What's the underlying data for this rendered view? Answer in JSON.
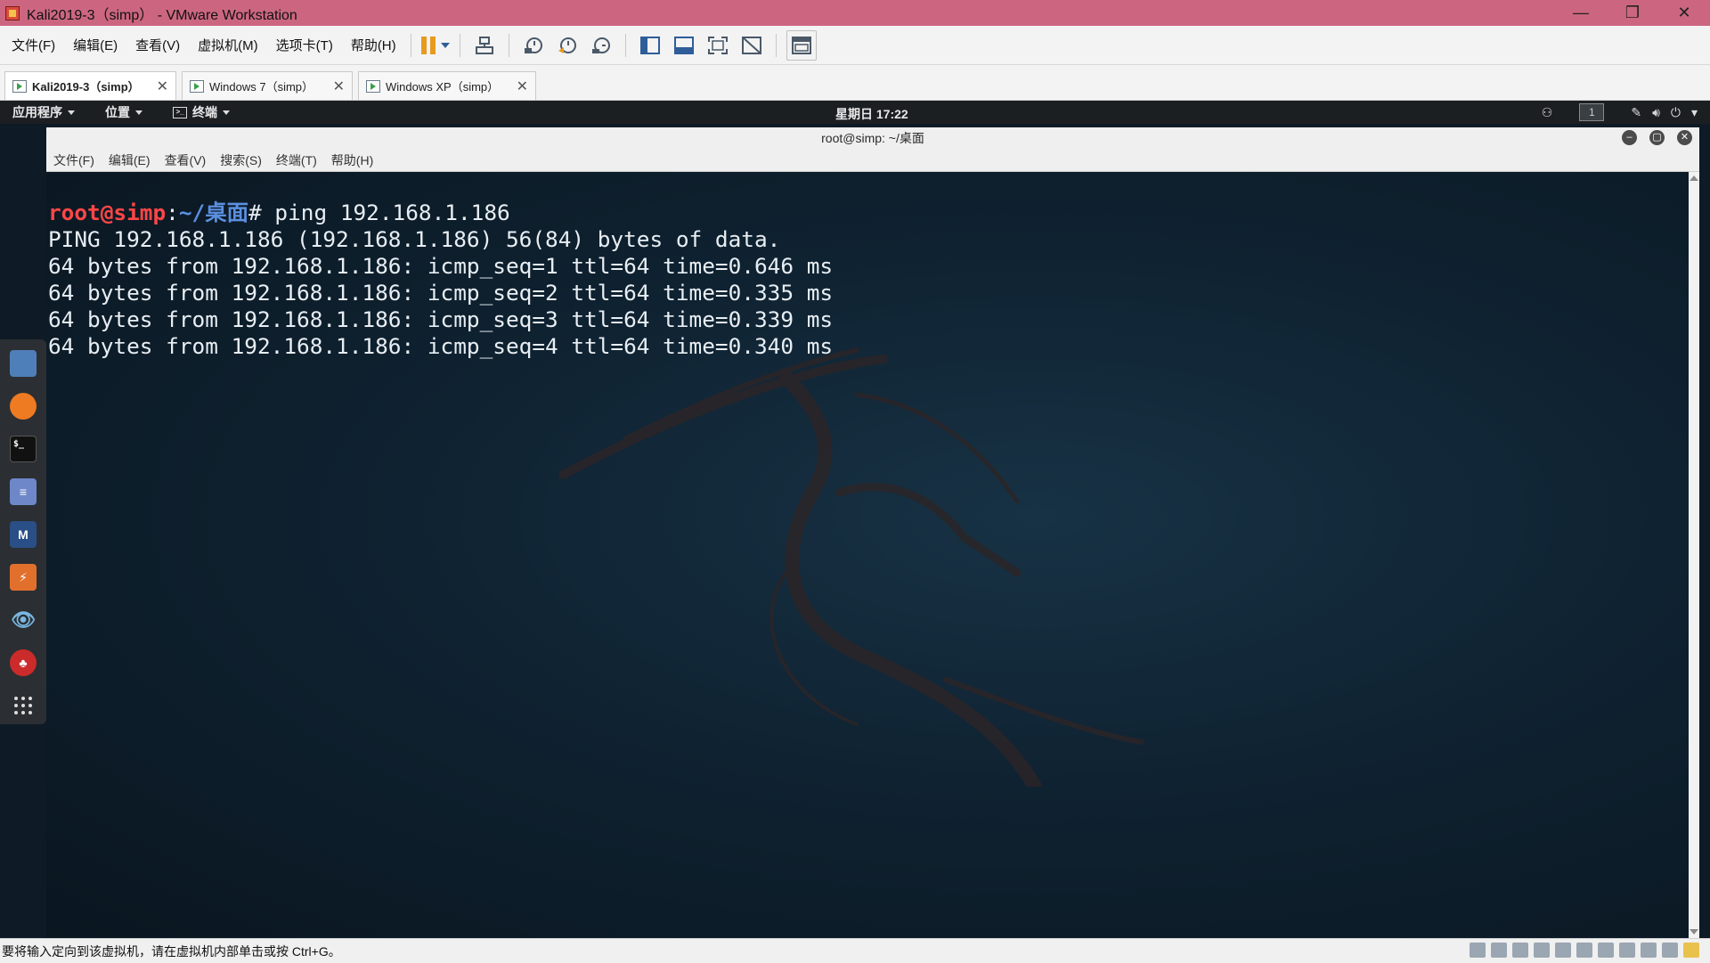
{
  "window": {
    "title": "Kali2019-3（simp） - VMware Workstation",
    "controls": {
      "minimize": "—",
      "restore": "❐",
      "close": "✕"
    }
  },
  "menubar": {
    "items": [
      "文件(F)",
      "编辑(E)",
      "查看(V)",
      "虚拟机(M)",
      "选项卡(T)",
      "帮助(H)"
    ]
  },
  "tabs": [
    {
      "label": "Kali2019-3（simp）",
      "active": true
    },
    {
      "label": "Windows 7（simp）",
      "active": false
    },
    {
      "label": "Windows XP（simp）",
      "active": false
    }
  ],
  "gnome": {
    "apps_menu": "应用程序",
    "places_menu": "位置",
    "terminal_menu": "终端",
    "clock": "星期日 17:22",
    "workspace": "1"
  },
  "dock": [
    {
      "name": "files-icon",
      "glyph": ""
    },
    {
      "name": "firefox-icon",
      "glyph": ""
    },
    {
      "name": "terminal-icon",
      "glyph": "$_"
    },
    {
      "name": "text-editor-icon",
      "glyph": "≡"
    },
    {
      "name": "metasploit-icon",
      "glyph": "M"
    },
    {
      "name": "burpsuite-icon",
      "glyph": "⚡"
    },
    {
      "name": "eye-icon",
      "glyph": "👁"
    },
    {
      "name": "cherrytree-icon",
      "glyph": "♣"
    },
    {
      "name": "show-apps-icon",
      "glyph": "⋮⋮⋮"
    }
  ],
  "terminal": {
    "title": "root@simp: ~/桌面",
    "menu": [
      "文件(F)",
      "编辑(E)",
      "查看(V)",
      "搜索(S)",
      "终端(T)",
      "帮助(H)"
    ],
    "prompt_user": "root@simp",
    "prompt_sep": ":",
    "prompt_path": "~/桌面",
    "prompt_symbol": "# ",
    "command": "ping 192.168.1.186",
    "output": [
      "PING 192.168.1.186 (192.168.1.186) 56(84) bytes of data.",
      "64 bytes from 192.168.1.186: icmp_seq=1 ttl=64 time=0.646 ms",
      "64 bytes from 192.168.1.186: icmp_seq=2 ttl=64 time=0.335 ms",
      "64 bytes from 192.168.1.186: icmp_seq=3 ttl=64 time=0.339 ms",
      "64 bytes from 192.168.1.186: icmp_seq=4 ttl=64 time=0.340 ms"
    ]
  },
  "statusbar": {
    "text": "要将输入定向到该虚拟机，请在虚拟机内部单击或按 Ctrl+G。"
  },
  "colors": {
    "titlebar": "#cc6680",
    "prompt_user": "#ff4646",
    "prompt_path": "#5b8fe0",
    "pause_icon": "#e89a1e"
  }
}
